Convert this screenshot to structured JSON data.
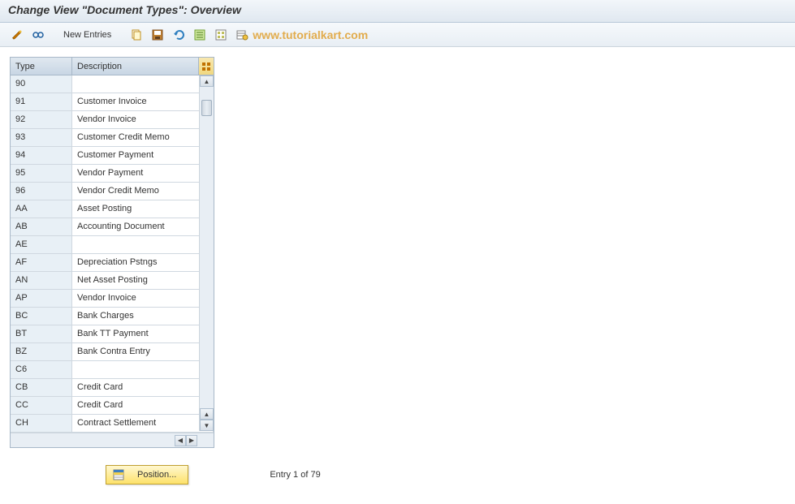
{
  "header": {
    "title": "Change View \"Document Types\": Overview"
  },
  "toolbar": {
    "new_entries_label": "New Entries"
  },
  "watermark": "www.tutorialkart.com",
  "table": {
    "columns": {
      "type": "Type",
      "description": "Description"
    },
    "rows": [
      {
        "type": "90",
        "desc": ""
      },
      {
        "type": "91",
        "desc": "Customer Invoice"
      },
      {
        "type": "92",
        "desc": "Vendor Invoice"
      },
      {
        "type": "93",
        "desc": "Customer Credit Memo"
      },
      {
        "type": "94",
        "desc": "Customer Payment"
      },
      {
        "type": "95",
        "desc": "Vendor Payment"
      },
      {
        "type": "96",
        "desc": "Vendor Credit Memo"
      },
      {
        "type": "AA",
        "desc": "Asset Posting"
      },
      {
        "type": "AB",
        "desc": "Accounting Document"
      },
      {
        "type": "AE",
        "desc": ""
      },
      {
        "type": "AF",
        "desc": "Depreciation Pstngs"
      },
      {
        "type": "AN",
        "desc": "Net Asset Posting"
      },
      {
        "type": "AP",
        "desc": "Vendor Invoice"
      },
      {
        "type": "BC",
        "desc": "Bank Charges"
      },
      {
        "type": "BT",
        "desc": "Bank TT Payment"
      },
      {
        "type": "BZ",
        "desc": "Bank Contra Entry"
      },
      {
        "type": "C6",
        "desc": ""
      },
      {
        "type": "CB",
        "desc": "Credit Card"
      },
      {
        "type": "CC",
        "desc": "Credit Card"
      },
      {
        "type": "CH",
        "desc": "Contract Settlement"
      }
    ]
  },
  "footer": {
    "position_label": "Position...",
    "entry_status": "Entry 1 of 79"
  }
}
